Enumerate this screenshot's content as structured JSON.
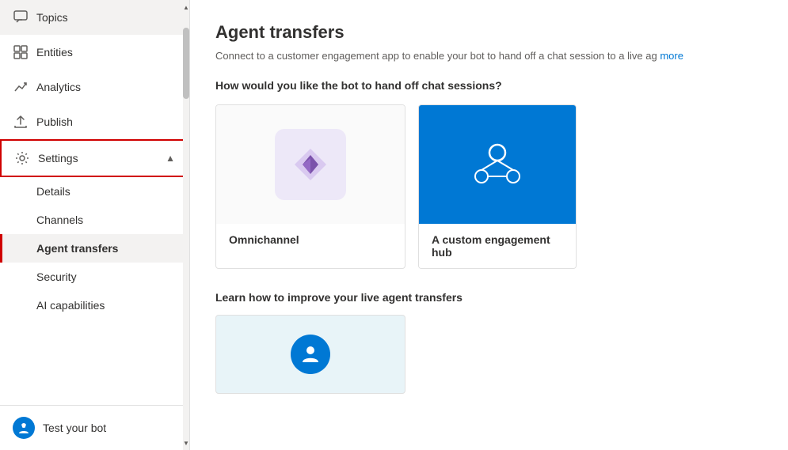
{
  "sidebar": {
    "items": [
      {
        "id": "topics",
        "label": "Topics",
        "icon": "speech-bubble"
      },
      {
        "id": "entities",
        "label": "Entities",
        "icon": "grid"
      },
      {
        "id": "analytics",
        "label": "Analytics",
        "icon": "trending-up"
      },
      {
        "id": "publish",
        "label": "Publish",
        "icon": "upload"
      },
      {
        "id": "settings",
        "label": "Settings",
        "icon": "gear",
        "expanded": true,
        "chevron": "▲"
      }
    ],
    "sub_items": [
      {
        "id": "details",
        "label": "Details"
      },
      {
        "id": "channels",
        "label": "Channels"
      },
      {
        "id": "agent-transfers",
        "label": "Agent transfers",
        "active": true
      },
      {
        "id": "security",
        "label": "Security"
      },
      {
        "id": "ai-capabilities",
        "label": "AI capabilities"
      }
    ],
    "bottom": {
      "label": "Test your bot",
      "icon": "robot"
    }
  },
  "main": {
    "title": "Agent transfers",
    "subtitle": "Connect to a customer engagement app to enable your bot to hand off a chat session to a live ag",
    "subtitle_link": "more",
    "how_title": "How would you like the bot to hand off chat sessions?",
    "cards": [
      {
        "id": "omnichannel",
        "label": "Omnichannel"
      },
      {
        "id": "custom-hub",
        "label": "A custom engagement hub"
      }
    ],
    "learn_title": "Learn how to improve your live agent transfers"
  }
}
